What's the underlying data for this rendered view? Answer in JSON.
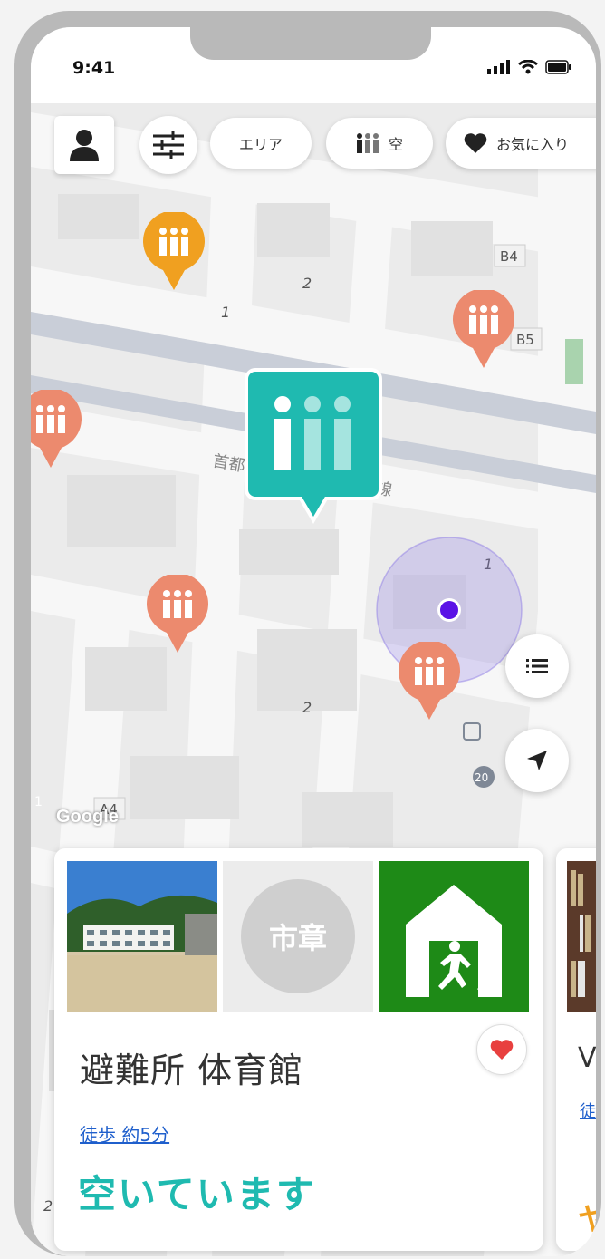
{
  "status_bar": {
    "time": "9:41"
  },
  "filters": {
    "area_label": "エリア",
    "vacancy_label": "空",
    "favorites_label": "お気に入り"
  },
  "map": {
    "labels": [
      "B4",
      "B5",
      "A4",
      "1",
      "2",
      "1",
      "1",
      "2",
      "20",
      "2"
    ],
    "road_text_1": "首都",
    "road_text_2": "線",
    "attribution": "Google"
  },
  "card": {
    "seal_text": "市章",
    "title": "避難所 体育館",
    "walk_time": "徒歩 約5分",
    "status": "空いています"
  },
  "card_next": {
    "title_start": "V",
    "walk_start": "徒",
    "status_start": "ヤ"
  },
  "colors": {
    "teal": "#1fbab0",
    "salmon": "#ec8a6e",
    "orange": "#f0a020",
    "location_dot": "#5b12e6",
    "exit_green": "#1e8a17",
    "heart_red": "#e8403f"
  },
  "icons": [
    "user-icon",
    "filter-sliders-icon",
    "people-icon",
    "heart-icon",
    "list-icon",
    "navigation-arrow-icon",
    "train-station-icon"
  ]
}
